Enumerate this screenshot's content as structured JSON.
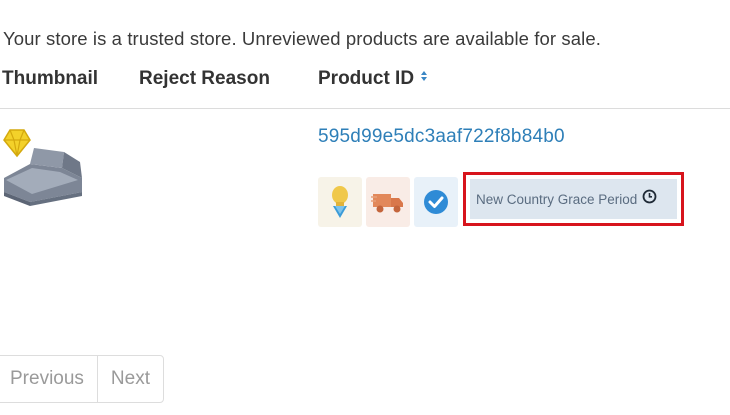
{
  "notice": "Your store is a trusted store. Unreviewed products are available for sale.",
  "table": {
    "headers": {
      "thumbnail": "Thumbnail",
      "reject_reason": "Reject Reason",
      "product_id": "Product ID"
    },
    "rows": [
      {
        "thumbnail_icon": "sofa-product-image",
        "product_id": "595d99e5dc3aaf722f8b84b0",
        "badges": [
          "bulb-medal-icon",
          "shipping-truck-icon",
          "verified-check-icon"
        ],
        "grace_label": "New Country Grace Period"
      }
    ]
  },
  "pagination": {
    "previous": "Previous",
    "next": "Next"
  },
  "colors": {
    "link": "#2e7fb8",
    "highlight_border": "#d7141c",
    "grace_bg": "#dde6ef"
  }
}
